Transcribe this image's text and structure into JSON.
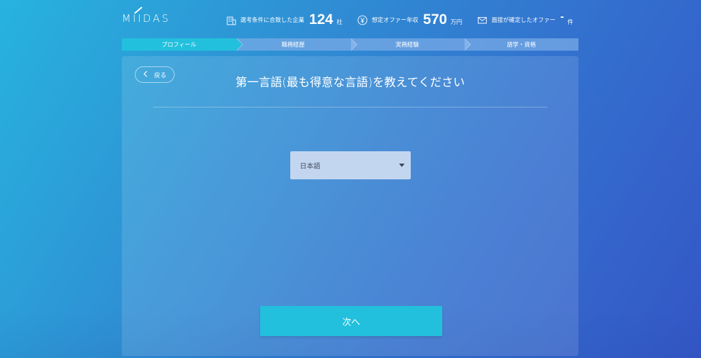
{
  "header": {
    "logo": "MIIDAS",
    "stats": [
      {
        "icon": "building-icon",
        "label": "選考条件に合致した企業",
        "value": "124",
        "unit": "社"
      },
      {
        "icon": "yen-icon",
        "label": "想定オファー年収",
        "value": "570",
        "unit": "万円"
      },
      {
        "icon": "mail-icon",
        "label": "面接が確定したオファー",
        "value": "-",
        "unit": "件"
      }
    ]
  },
  "steps": [
    {
      "label": "プロフィール",
      "active": true
    },
    {
      "label": "職務経歴",
      "active": false
    },
    {
      "label": "実務経験",
      "active": false
    },
    {
      "label": "語学・資格",
      "active": false
    }
  ],
  "card": {
    "back_label": "戻る",
    "question": "第一言語(最も得意な言語)を教えてください",
    "select_value": "日本語",
    "next_label": "次へ"
  },
  "colors": {
    "accent": "#23c0dd",
    "select_bg": "#c3d6ef"
  }
}
